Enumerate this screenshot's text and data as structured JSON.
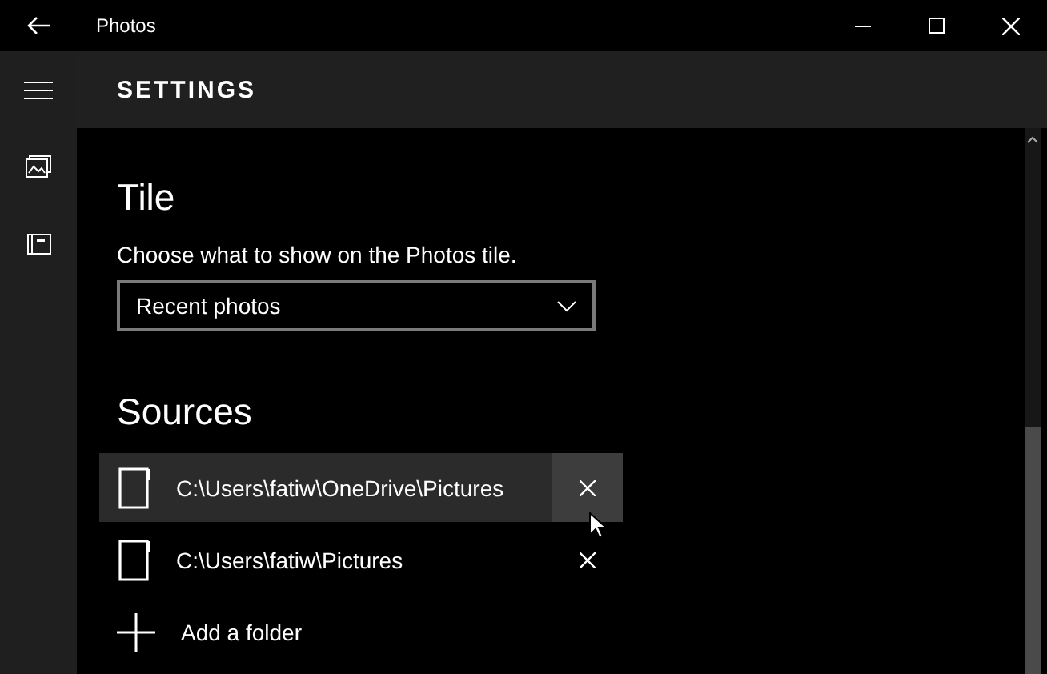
{
  "window": {
    "title": "Photos"
  },
  "header": {
    "title": "SETTINGS"
  },
  "tile": {
    "heading": "Tile",
    "description": "Choose what to show on the Photos tile.",
    "dropdown": {
      "value": "Recent photos"
    }
  },
  "sources": {
    "heading": "Sources",
    "folders": [
      {
        "path": "C:\\Users\\fatiw\\OneDrive\\Pictures",
        "hovered": true
      },
      {
        "path": "C:\\Users\\fatiw\\Pictures",
        "hovered": false
      }
    ],
    "add_label": "Add a folder"
  }
}
